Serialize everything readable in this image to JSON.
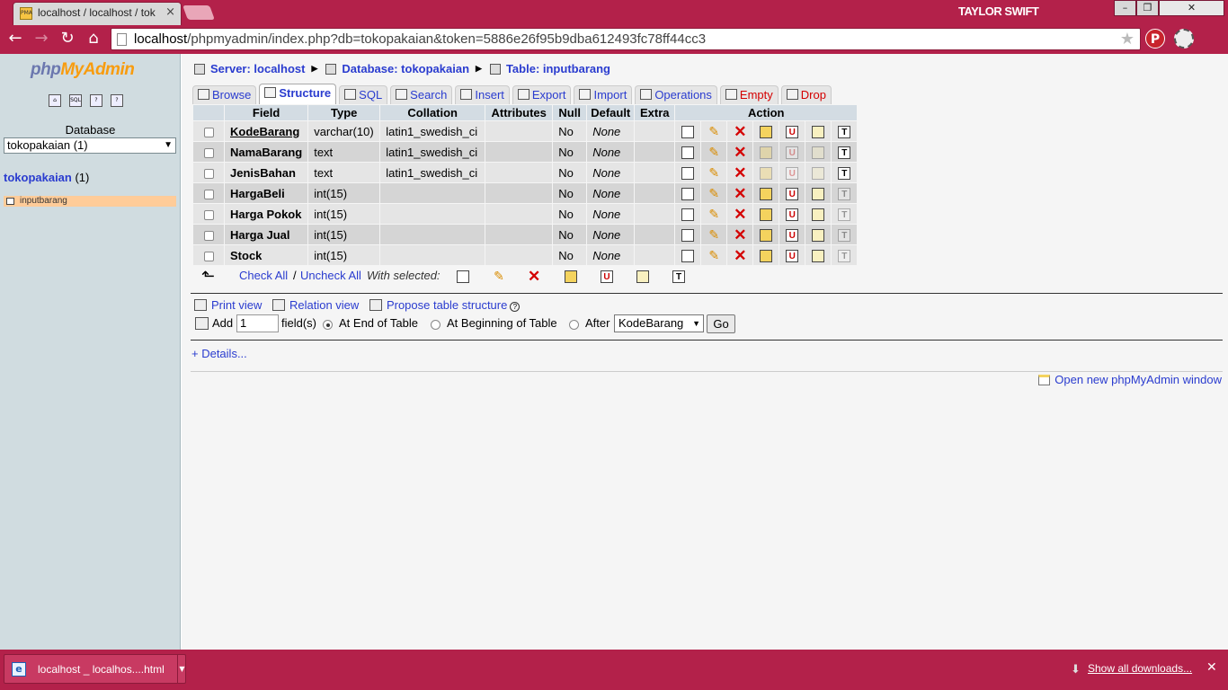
{
  "browser": {
    "tab_title": "localhost / localhost / tok",
    "tab_close": "×",
    "user_name": "TAYLOR SWIFT",
    "window_buttons": {
      "minimize": "–",
      "maximize": "❐",
      "close": "✕"
    },
    "url_host": "localhost",
    "url_rest": "/phpmyadmin/index.php?db=tokopakaian&token=5886e26f95b9dba612493fc78ff44cc3",
    "icons": [
      "back-arrow",
      "forward-arrow",
      "reload",
      "home",
      "star",
      "pinterest",
      "extension",
      "menu"
    ]
  },
  "sidebar": {
    "logo_php": "php",
    "logo_myadmin": "MyAdmin",
    "label": "Database",
    "db_select_value": "tokopakaian (1)",
    "db_name": "tokopakaian",
    "db_count": " (1)",
    "table_name": "inputbarang",
    "highlight_color": "#ffcc99"
  },
  "breadcrumb": {
    "server": "Server: localhost",
    "database": "Database: tokopakaian",
    "table": "Table: inputbarang"
  },
  "tabs": [
    {
      "label": "Browse"
    },
    {
      "label": "Structure",
      "active": true
    },
    {
      "label": "SQL"
    },
    {
      "label": "Search"
    },
    {
      "label": "Insert"
    },
    {
      "label": "Export"
    },
    {
      "label": "Import"
    },
    {
      "label": "Operations"
    },
    {
      "label": "Empty",
      "danger": true
    },
    {
      "label": "Drop",
      "danger": true
    }
  ],
  "columns": [
    "Field",
    "Type",
    "Collation",
    "Attributes",
    "Null",
    "Default",
    "Extra",
    "Action"
  ],
  "rows": [
    {
      "field": "KodeBarang",
      "type": "varchar(10)",
      "collation": "latin1_swedish_ci",
      "attributes": "",
      "null": "No",
      "default": "None",
      "extra": "",
      "primary": true
    },
    {
      "field": "NamaBarang",
      "type": "text",
      "collation": "latin1_swedish_ci",
      "attributes": "",
      "null": "No",
      "default": "None",
      "extra": ""
    },
    {
      "field": "JenisBahan",
      "type": "text",
      "collation": "latin1_swedish_ci",
      "attributes": "",
      "null": "No",
      "default": "None",
      "extra": ""
    },
    {
      "field": "HargaBeli",
      "type": "int(15)",
      "collation": "",
      "attributes": "",
      "null": "No",
      "default": "None",
      "extra": ""
    },
    {
      "field": "Harga Pokok",
      "type": "int(15)",
      "collation": "",
      "attributes": "",
      "null": "No",
      "default": "None",
      "extra": ""
    },
    {
      "field": "Harga Jual",
      "type": "int(15)",
      "collation": "",
      "attributes": "",
      "null": "No",
      "default": "None",
      "extra": ""
    },
    {
      "field": "Stock",
      "type": "int(15)",
      "collation": "",
      "attributes": "",
      "null": "No",
      "default": "None",
      "extra": ""
    }
  ],
  "bulk": {
    "check_all": "Check All",
    "separator": "/",
    "uncheck_all": "Uncheck All",
    "with_selected": "With selected:"
  },
  "links": {
    "print_view": "Print view",
    "relation_view": "Relation view",
    "propose": "Propose table structure",
    "help": "?"
  },
  "add_fields": {
    "add_label": "Add",
    "count": "1",
    "fields_label": "field(s)",
    "at_end": "At End of Table",
    "at_beginning": "At Beginning of Table",
    "after": "After",
    "after_value": "KodeBarang",
    "go": "Go",
    "selected_position": "end"
  },
  "details": "+ Details...",
  "open_new_window": "Open new phpMyAdmin window",
  "download": {
    "file_name": "localhost _ localhos....html",
    "show_all": "Show all downloads...",
    "close": "✕"
  },
  "colors": {
    "chrome": "#b3214a",
    "link": "#2a3ccf",
    "danger": "#d40000",
    "sidebar": "#d0dce0"
  }
}
